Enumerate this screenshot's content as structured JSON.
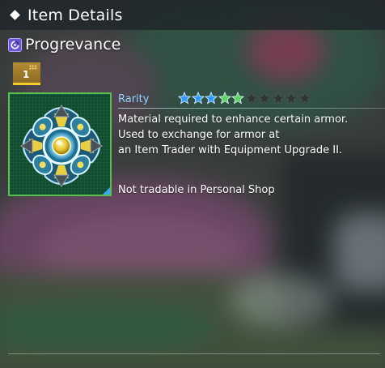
{
  "header": {
    "title": "Item Details"
  },
  "item": {
    "name": "Progrevance",
    "type_icon": "item-type-icon",
    "quantity": "1",
    "rarity_label": "Rarity",
    "rarity_total_stars": 10,
    "rarity_filled_stars": 5,
    "star_colors": [
      "#2f9bff",
      "#2f9bff",
      "#2f9bff",
      "#59d65a",
      "#59d65a"
    ],
    "star_empty_color": "#2e3336",
    "description_lines": [
      "Material required to enhance certain armor.",
      "Used to exchange for armor at",
      "an Item Trader with Equipment Upgrade II."
    ],
    "trade_note": "Not tradable in Personal Shop",
    "frame_color": "#56c04f"
  }
}
